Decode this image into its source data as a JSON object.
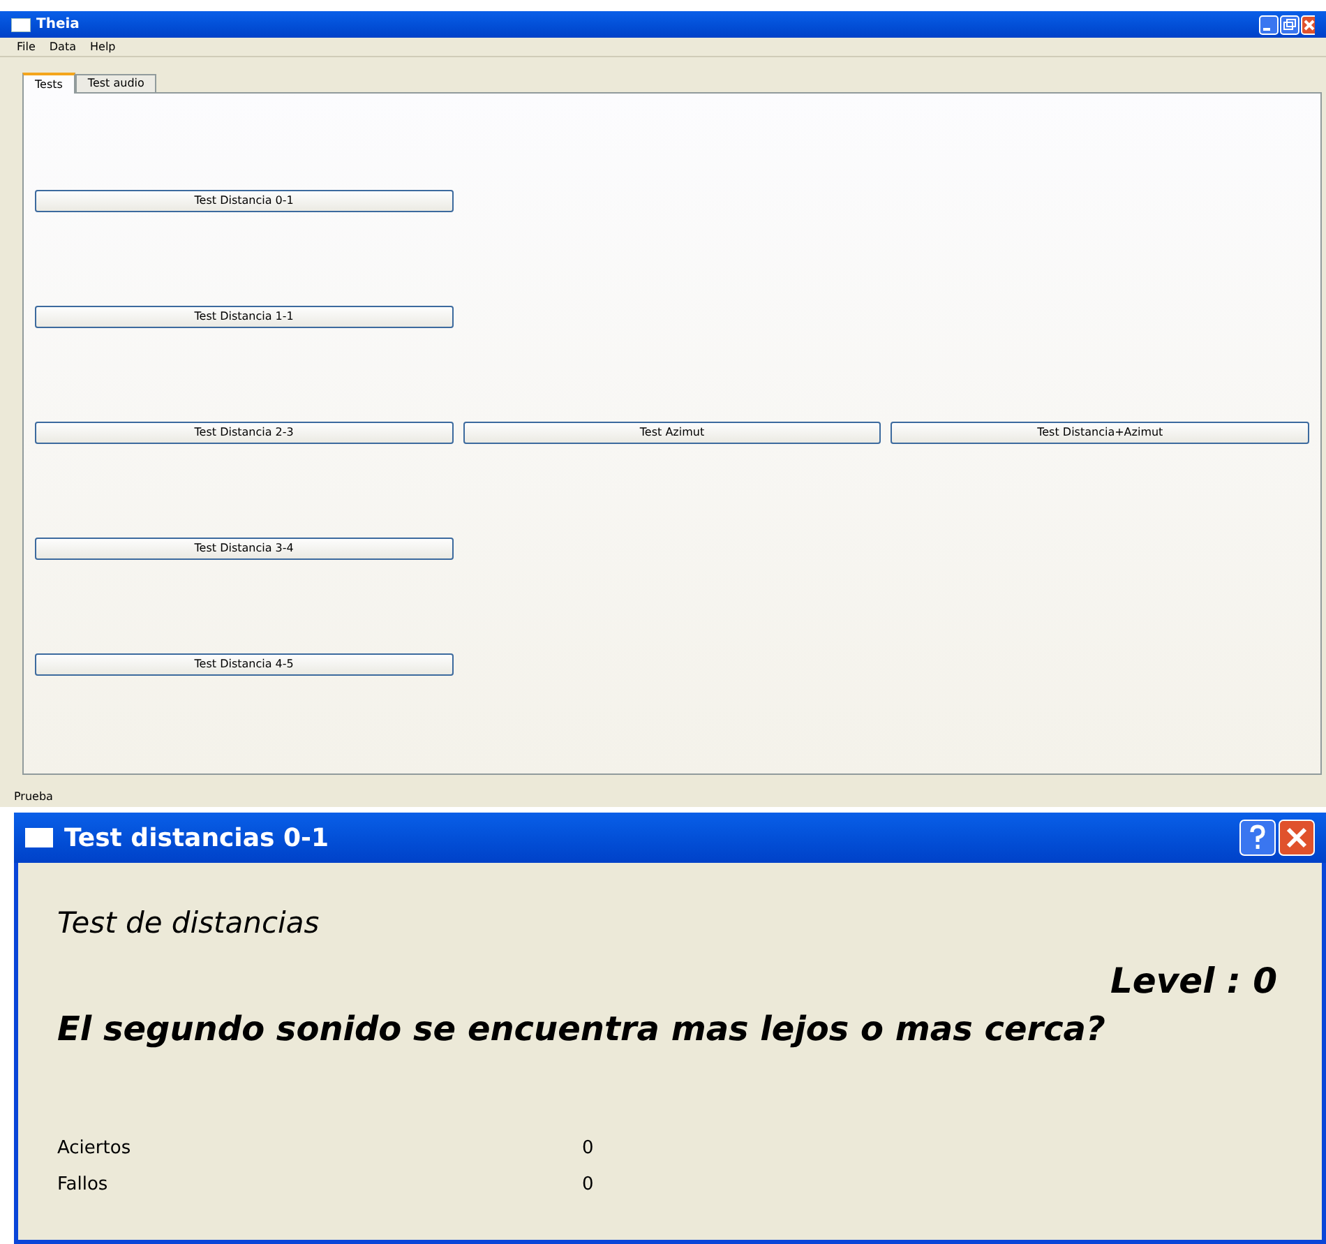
{
  "main_window": {
    "title": "Theia",
    "menu": [
      "File",
      "Data",
      "Help"
    ],
    "tabs": [
      {
        "label": "Tests",
        "selected": true
      },
      {
        "label": "Test audio",
        "selected": false
      }
    ],
    "button_rows": [
      [
        "Test Distancia 0-1"
      ],
      [
        "Test Distancia 1-1"
      ],
      [
        "Test Distancia 2-3",
        "Test Azimut",
        "Test Distancia+Azimut"
      ],
      [
        "Test Distancia 3-4"
      ],
      [
        "Test Distancia 4-5"
      ]
    ],
    "status_bar": "Prueba"
  },
  "dialog": {
    "title": "Test distancias 0-1",
    "heading": "Test de distancias",
    "level": "Level : 0",
    "question": "El segundo sonido se encuentra mas lejos o mas cerca?",
    "stats": [
      {
        "label": "Aciertos",
        "value": "0"
      },
      {
        "label": "Fallos",
        "value": "0"
      }
    ]
  }
}
